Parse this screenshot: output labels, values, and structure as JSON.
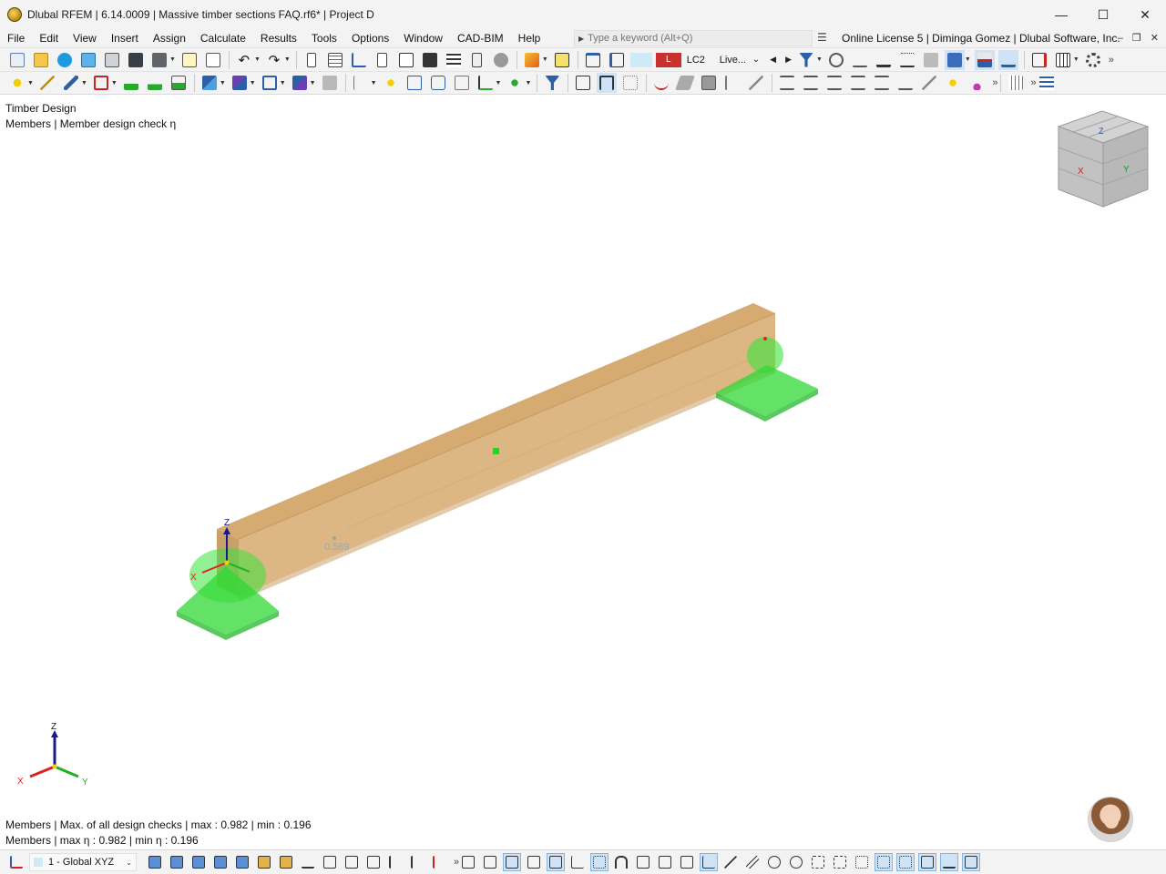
{
  "window": {
    "title": "Dlubal RFEM | 6.14.0009 | Massive timber sections FAQ.rf6* | Project D",
    "minimize": "—",
    "maximize": "☐",
    "close": "✕"
  },
  "menu": {
    "items": [
      "File",
      "Edit",
      "View",
      "Insert",
      "Assign",
      "Calculate",
      "Results",
      "Tools",
      "Options",
      "Window",
      "CAD-BIM",
      "Help"
    ],
    "search_placeholder": "Type a keyword (Alt+Q)",
    "license": "Online License 5 | Diminga Gomez | Dlubal Software, Inc.",
    "mdi_minimize": "–",
    "mdi_restore": "❐",
    "mdi_close": "✕"
  },
  "toolbar": {
    "load_case_type": "L",
    "load_case": "LC2",
    "load_combo": "Live...",
    "more": "»"
  },
  "viewport": {
    "module": "Timber Design",
    "result_type": "Members | Member design check η",
    "max_label": "0.589",
    "axis_labels": {
      "x": "X",
      "y": "Y",
      "z": "Z"
    },
    "info_line1": "Members | Max. of all design checks | max  : 0.982 | min  : 0.196",
    "info_line2": "Members | max η : 0.982 | min η : 0.196",
    "colors": {
      "beam": "#d8b07a",
      "support": "#35e03a",
      "axis_x": "#e02020",
      "axis_y": "#20b020",
      "axis_z": "#1a1a8a"
    }
  },
  "statusbar": {
    "coordinate_system": "1 - Global XYZ",
    "more": "»"
  }
}
